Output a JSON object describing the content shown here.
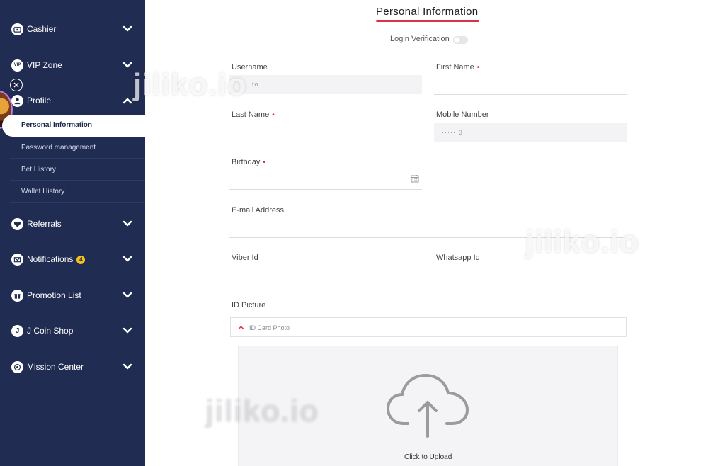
{
  "sidebar": {
    "items": [
      {
        "label": "Cashier",
        "icon": "wallet-icon"
      },
      {
        "label": "VIP Zone",
        "icon": "vip-icon"
      },
      {
        "label": "Profile",
        "icon": "user-icon"
      },
      {
        "label": "Referrals",
        "icon": "heart-icon"
      },
      {
        "label": "Notifications",
        "icon": "mail-icon",
        "badge": "4"
      },
      {
        "label": "Promotion List",
        "icon": "gift-icon"
      },
      {
        "label": "J Coin Shop",
        "icon": "coin-icon"
      },
      {
        "label": "Mission Center",
        "icon": "target-icon"
      }
    ],
    "profile_sub": [
      {
        "label": "Personal Information",
        "active": true
      },
      {
        "label": "Password management"
      },
      {
        "label": "Bet History"
      },
      {
        "label": "Wallet History"
      }
    ]
  },
  "main": {
    "title": "Personal Information",
    "login_verification": "Login Verification",
    "required_mark": "•",
    "fields": {
      "username": {
        "label": "Username",
        "value": "to"
      },
      "first_name": {
        "label": "First Name"
      },
      "last_name": {
        "label": "Last Name"
      },
      "mobile": {
        "label": "Mobile Number",
        "value": "·······3"
      },
      "birthday": {
        "label": "Birthday"
      },
      "email": {
        "label": "E-mail Address"
      },
      "viber": {
        "label": "Viber Id"
      },
      "whatsapp": {
        "label": "Whatsapp Id"
      },
      "id_picture": {
        "label": "ID Picture"
      }
    },
    "accordion": {
      "label": "ID Card Photo"
    },
    "upload": {
      "label": "Click to Upload"
    }
  },
  "watermark": "jiliko.io",
  "colors": {
    "sidebar_bg": "#212c52",
    "accent": "#d8324a",
    "badge": "#f1c21b"
  }
}
